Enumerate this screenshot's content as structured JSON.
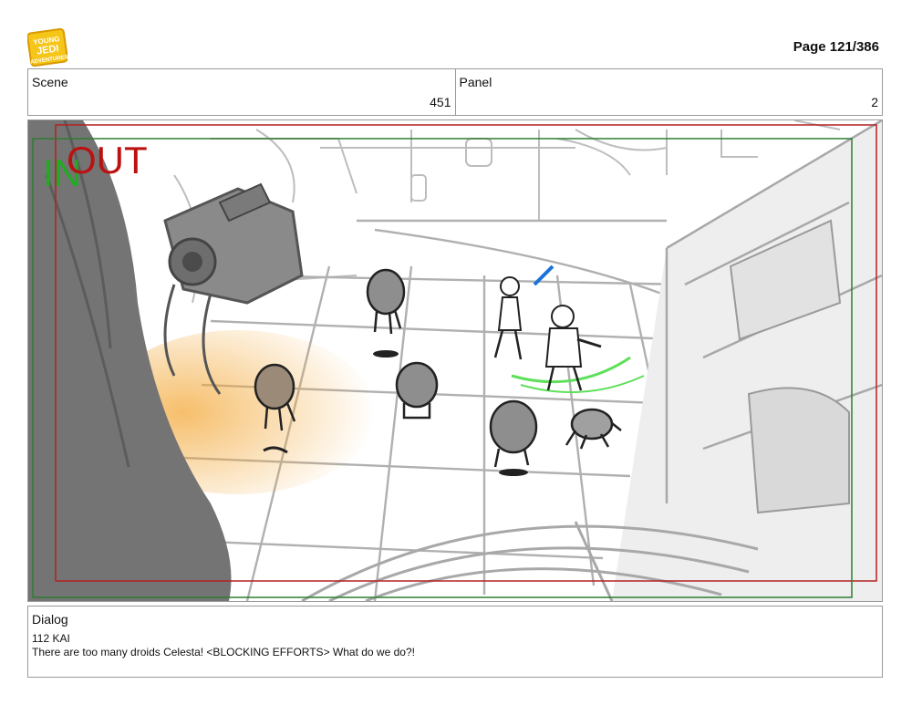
{
  "brand": {
    "logo_text": "YOUNG JEDI ADVENTURES",
    "logo_color": "#f5c518"
  },
  "page": {
    "label": "Page 121/386"
  },
  "scene": {
    "label": "Scene",
    "value": "451"
  },
  "panel": {
    "label": "Panel",
    "value": "2"
  },
  "frame_marks": {
    "in_label": "IN",
    "out_label": "OUT",
    "in_color": "#22aa22",
    "out_color": "#bb1111"
  },
  "dialog": {
    "label": "Dialog",
    "speaker": "112 KAI",
    "text": "There are too many droids Celesta! <BLOCKING EFFORTS> What do we do?!"
  }
}
